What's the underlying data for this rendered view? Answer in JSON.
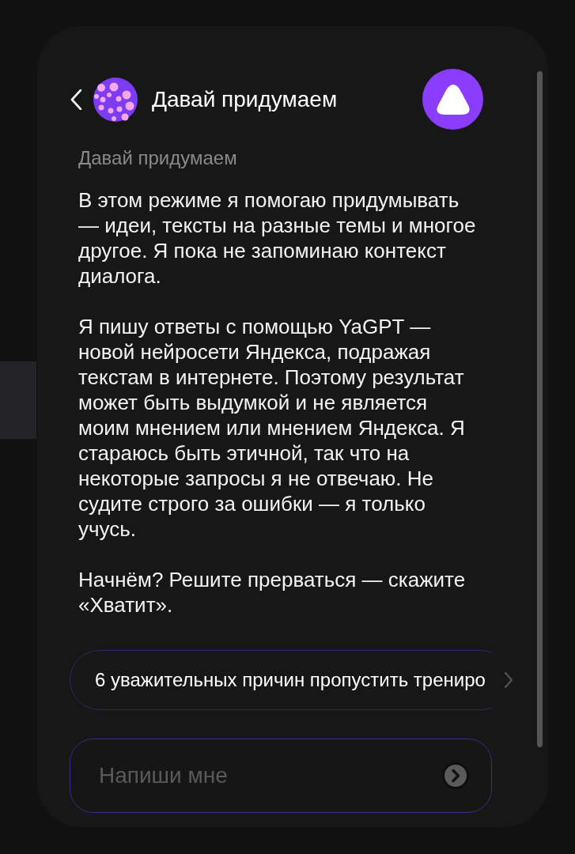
{
  "header": {
    "title": "Давай придумаем"
  },
  "message": {
    "sender": "Давай придумаем",
    "paragraphs": [
      "В этом режиме я помогаю придумывать — идеи, тексты на разные темы и многое другое. Я пока не запоминаю контекст диалога.",
      "Я пишу ответы с помощью YaGPT — новой нейросети Яндекса, подражая текстам в интернете. Поэтому результат может быть выдумкой и не является моим мнением или мнением Яндекса. Я стараюсь быть этичной, так что на некоторые запросы я не отвечаю. Не судите строго за ошибки — я только учусь.",
      "Начнём? Решите прерваться — скажите «Хватит»."
    ]
  },
  "suggestions": [
    {
      "label": "6 уважительных причин пропустить трениро"
    }
  ],
  "input": {
    "placeholder": "Напиши мне"
  }
}
